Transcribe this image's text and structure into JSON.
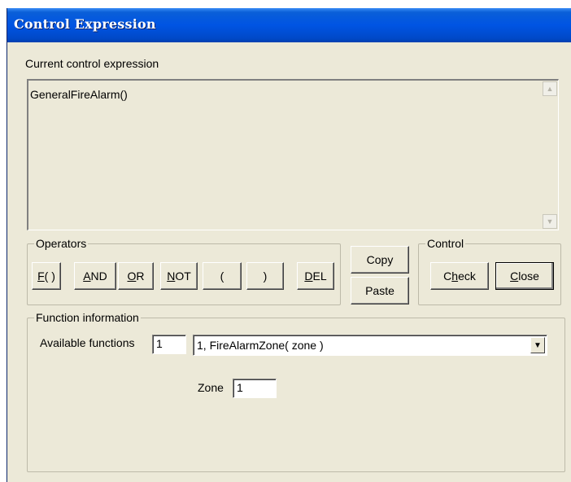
{
  "window": {
    "title": "Control Expression"
  },
  "expression": {
    "label": "Current control expression",
    "value": "GeneralFireAlarm()"
  },
  "operators": {
    "label": "Operators",
    "buttons": [
      {
        "mnemonic": "F",
        "rest": "( )"
      },
      {
        "mnemonic": "A",
        "rest": "ND"
      },
      {
        "mnemonic": "O",
        "rest": "R"
      },
      {
        "mnemonic": "N",
        "rest": "OT"
      },
      {
        "mnemonic": "",
        "rest": "("
      },
      {
        "mnemonic": "",
        "rest": ")"
      },
      {
        "mnemonic": "D",
        "rest": "EL"
      }
    ]
  },
  "clipboard": {
    "copy_label": "Copy",
    "paste_label": "Paste"
  },
  "control": {
    "label": "Control",
    "check": {
      "pre": "C",
      "mnemonic": "h",
      "rest": "eck"
    },
    "close": {
      "mnemonic": "C",
      "rest": "lose"
    }
  },
  "function_info": {
    "label": "Function information",
    "available_label": "Available functions",
    "available_count": "1",
    "selected_function": "1, FireAlarmZone( zone )",
    "param_label": "Zone",
    "param_value": "1"
  },
  "icons": {
    "scroll_up": "chevron-up-icon",
    "scroll_down": "chevron-down-icon",
    "dropdown": "dropdown-arrow-icon"
  }
}
